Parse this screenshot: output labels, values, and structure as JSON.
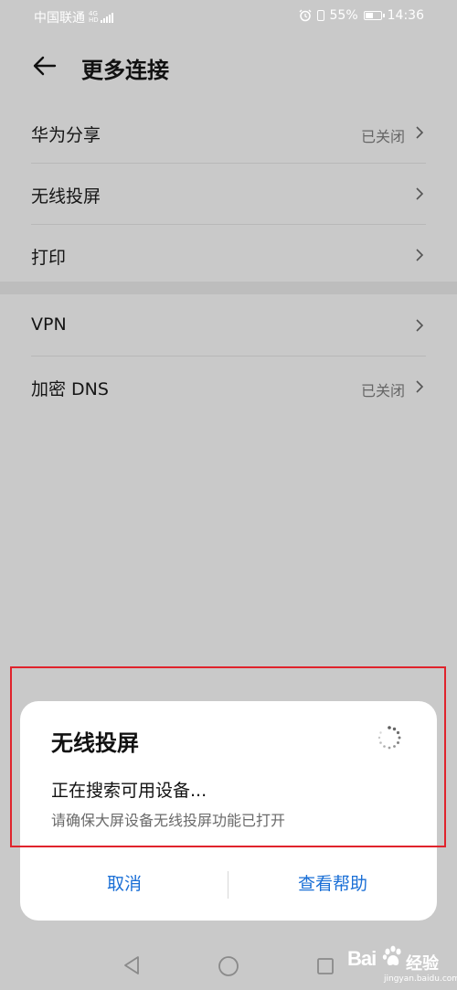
{
  "status_bar": {
    "carrier": "中国联通",
    "network_badge_top": "4G",
    "network_badge_bottom": "HD",
    "battery": "55%",
    "battery_level": 0.55,
    "time": "14:36"
  },
  "header": {
    "title": "更多连接"
  },
  "settings": {
    "group1": [
      {
        "label": "华为分享",
        "value": "已关闭"
      },
      {
        "label": "无线投屏",
        "value": ""
      },
      {
        "label": "打印",
        "value": ""
      }
    ],
    "group2": [
      {
        "label": "VPN",
        "value": ""
      },
      {
        "label": "加密 DNS",
        "value": "已关闭"
      }
    ]
  },
  "dialog": {
    "title": "无线投屏",
    "status": "正在搜索可用设备...",
    "hint": "请确保大屏设备无线投屏功能已打开",
    "cancel": "取消",
    "help": "查看帮助"
  },
  "colors": {
    "accent": "#1a6fd6",
    "annotation": "#e0232c",
    "dimmed_background": "#c9c9c9"
  },
  "watermark": {
    "brand": "Bai",
    "sub": "经验",
    "url": "jingyan.baidu.com"
  },
  "icons": {
    "back": "arrow-left-icon",
    "chevron": "chevron-right-icon",
    "spinner": "loading-spinner-icon",
    "nav_back": "triangle-back-icon",
    "nav_home": "circle-home-icon",
    "nav_recent": "square-recent-icon"
  }
}
